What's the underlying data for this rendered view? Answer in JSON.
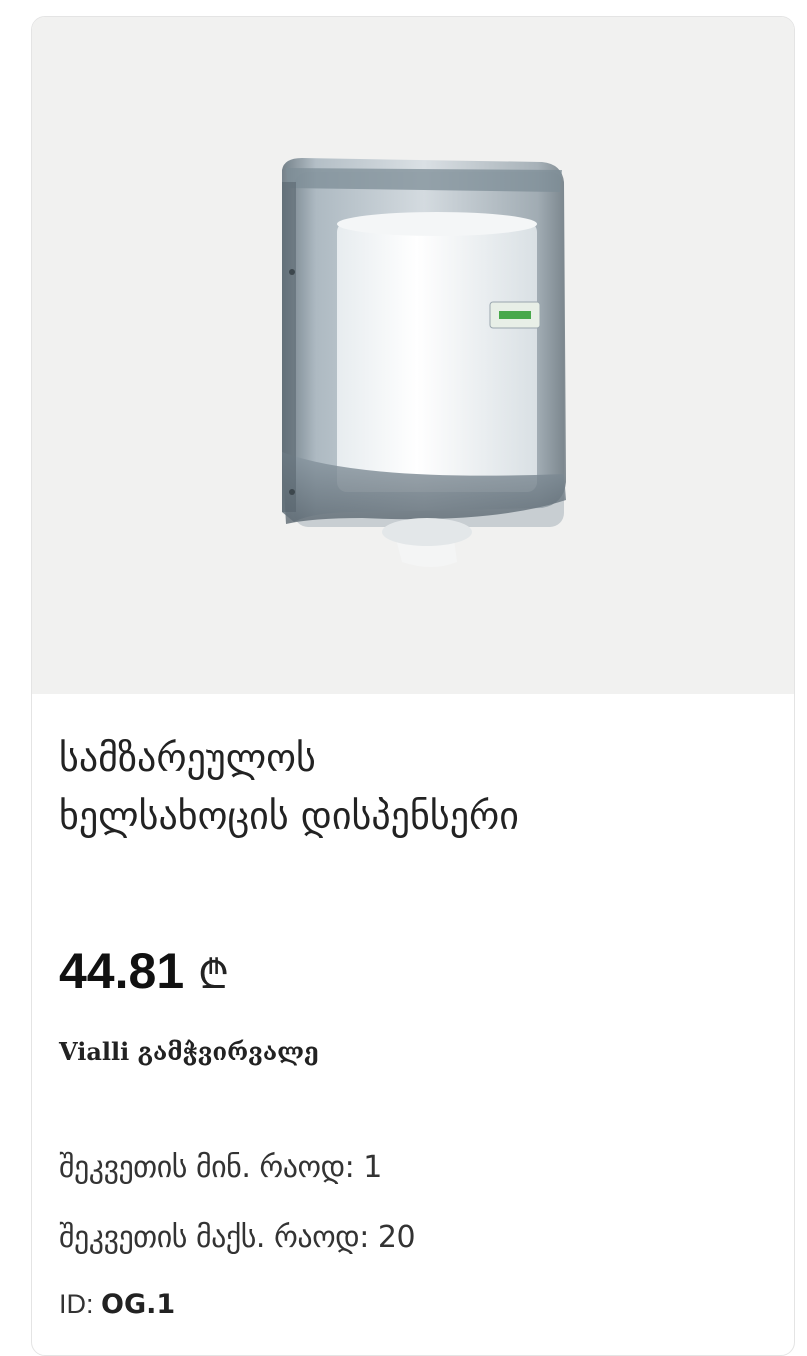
{
  "product": {
    "title_line1": "სამზარეულოს",
    "title_line2": "ხელსახოცის დისპენსერი",
    "price": "44.81",
    "currency_symbol": "₾",
    "brand_line": "Vialli გამჭვირვალე",
    "min_qty_label": "შეკვეთის მინ. რაოდ:",
    "min_qty_value": "1",
    "max_qty_label": "შეკვეთის მაქს. რაოდ:",
    "max_qty_value": "20",
    "id_label": "ID:",
    "id_value": "OG.1"
  },
  "colors": {
    "image_background": "#f1f1f0",
    "card_border": "#e4e4e4"
  }
}
